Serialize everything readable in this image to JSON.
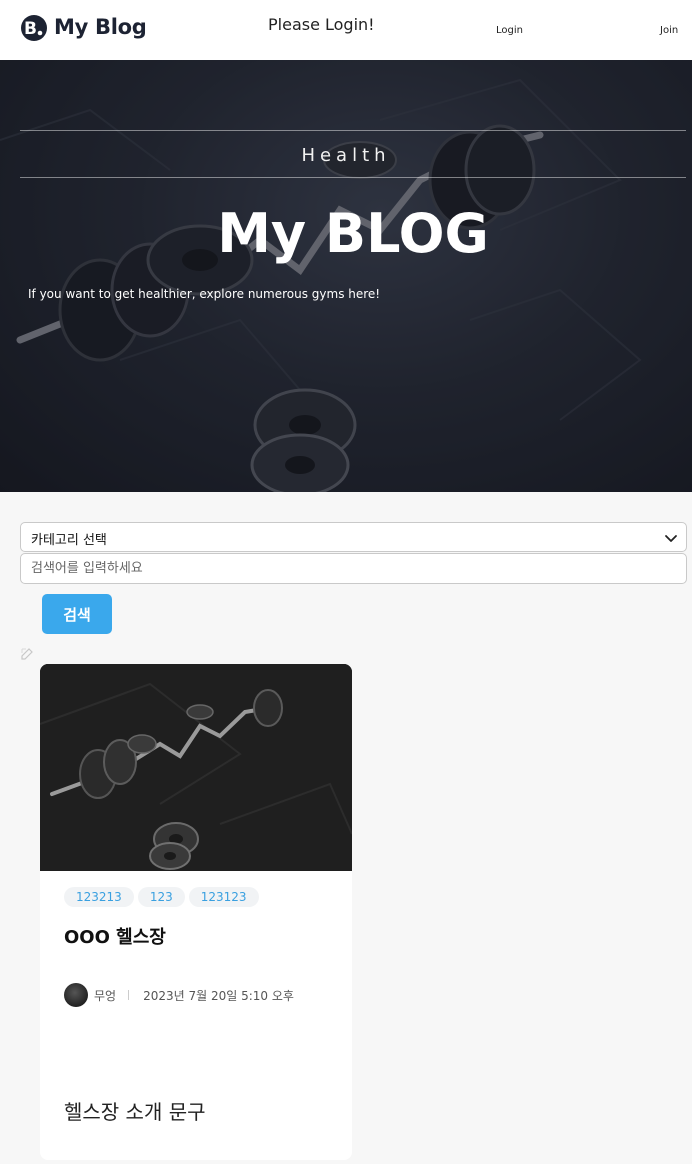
{
  "header": {
    "logo_text": "My Blog",
    "login_message": "Please Login!",
    "nav": {
      "login": "Login",
      "join": "Join"
    }
  },
  "hero": {
    "subtitle": "Health",
    "title": "My BLOG",
    "description": "If you want to get healthier, explore numerous gyms here!"
  },
  "search": {
    "category_select": "카테고리 선택",
    "input_placeholder": "검색어를 입력하세요",
    "button_label": "검색"
  },
  "posts": [
    {
      "tags": [
        "123213",
        "123",
        "123123"
      ],
      "title": "OOO 헬스장",
      "author": "무엉",
      "date": "2023년 7월 20일 5:10 오후",
      "description": "헬스장 소개 문구"
    }
  ],
  "colors": {
    "accent": "#3aa8ec",
    "header_bg": "#ffffff",
    "page_bg": "#f7f7f7"
  }
}
